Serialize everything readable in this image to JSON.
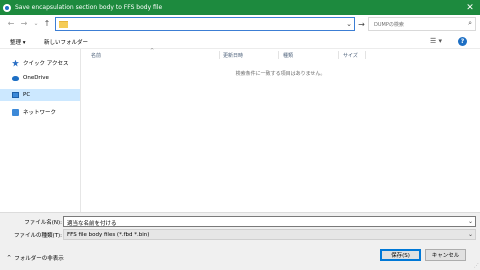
{
  "window": {
    "title": "Save encapsulation section body to FFS body file",
    "close_glyph": "✕"
  },
  "navigation": {
    "back_glyph": "←",
    "forward_glyph": "→",
    "recent_glyph": "⌄",
    "up_glyph": "↑",
    "address_dropdown_glyph": "⌄",
    "refresh_glyph": "→"
  },
  "search": {
    "placeholder": "DUMPの検索",
    "icon_glyph": "⌕"
  },
  "toolbar": {
    "organize_label": "整理 ▾",
    "new_folder_label": "新しいフォルダー",
    "view_glyph": "☰ ▾",
    "help_glyph": "?"
  },
  "sidebar": {
    "items": [
      {
        "label": "クイック アクセス",
        "icon": "star-icon"
      },
      {
        "label": "OneDrive",
        "icon": "cloud-icon"
      },
      {
        "label": "PC",
        "icon": "pc-icon",
        "selected": true
      },
      {
        "label": "ネットワーク",
        "icon": "network-icon"
      }
    ]
  },
  "file_list": {
    "columns": [
      "名前",
      "更新日時",
      "種類",
      "サイズ"
    ],
    "sort_glyph": "^",
    "empty_message": "検索条件に一致する項目はありません。"
  },
  "form": {
    "filename_label": "ファイル名(N):",
    "filename_value": "適当な名前を付ける",
    "filetype_label": "ファイルの種類(T):",
    "filetype_value": "FFS file body files (*.fbd *.bin)",
    "dropdown_glyph": "⌄"
  },
  "footer": {
    "hide_folders_label": "フォルダーの非表示",
    "hide_folders_glyph": "^",
    "save_label": "保存(S)",
    "cancel_label": "キャンセル",
    "grip_glyph": "⋰"
  },
  "colors": {
    "titlebar": "#1d8a3e",
    "selection": "#cce8ff",
    "address_border": "#3c7ed4"
  }
}
